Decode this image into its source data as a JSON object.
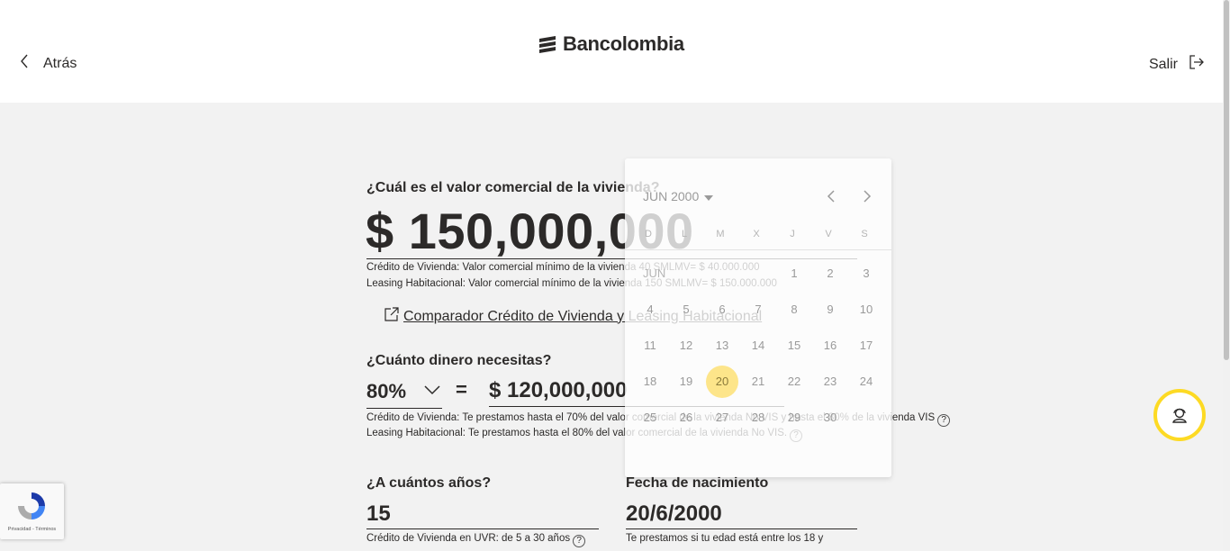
{
  "header": {
    "back_label": "Atrás",
    "brand": "Bancolombia",
    "exit_label": "Salir"
  },
  "property": {
    "question": "¿Cuál es el valor comercial de la vivienda?",
    "value": "$ 150,000,000",
    "note_credit": "Crédito de Vivienda: Valor comercial mínimo de la vivienda 40 SMLMV= $ 40.000.000",
    "note_leasing": "Leasing Habitacional: Valor comercial mínimo de la vivienda 150 SMLMV= $ 150.000.000"
  },
  "comparator": {
    "label": "Comparador Crédito de Vivienda y Leasing Habitacional"
  },
  "loan": {
    "question": "¿Cuánto dinero necesitas?",
    "percent": "80%",
    "equals": "=",
    "amount": "$ 120,000,000",
    "note_credit": "Crédito de Vivienda: Te prestamos hasta el 70% del valor comercial de la vivienda No VIS y hasta el 80% de la vivienda VIS",
    "note_leasing": "Leasing Habitacional: Te prestamos hasta el 80% del valor comercial de la vivienda No VIS.",
    "help_glyph": "?"
  },
  "years": {
    "question": "¿A cuántos años?",
    "value": "15",
    "note": "Crédito de Vivienda en UVR: de 5 a 30 años"
  },
  "birthdate": {
    "question": "Fecha de nacimiento",
    "value": "20/6/2000",
    "note": "Te prestamos si tu edad está entre los 18 y"
  },
  "calendar": {
    "month_year": "JUN 2000",
    "month_label": "JUN",
    "weekdays": [
      "D",
      "L",
      "M",
      "X",
      "J",
      "V",
      "S"
    ],
    "weeks": [
      [
        "",
        "",
        "",
        "",
        "1",
        "2",
        "3"
      ],
      [
        "4",
        "5",
        "6",
        "7",
        "8",
        "9",
        "10"
      ],
      [
        "11",
        "12",
        "13",
        "14",
        "15",
        "16",
        "17"
      ],
      [
        "18",
        "19",
        "20",
        "21",
        "22",
        "23",
        "24"
      ],
      [
        "25",
        "26",
        "27",
        "28",
        "29",
        "30",
        ""
      ]
    ],
    "selected": "20"
  },
  "recaptcha": {
    "footer": "Privacidad - Términos"
  },
  "colors": {
    "brand_yellow": "#fdda24",
    "selected_day": "#fde58a",
    "text": "#2c2a29",
    "background": "#f2f2f2"
  },
  "icons": {
    "back": "chevron-left-icon",
    "exit": "logout-icon",
    "external": "external-link-icon",
    "assistant": "assistant-icon"
  }
}
